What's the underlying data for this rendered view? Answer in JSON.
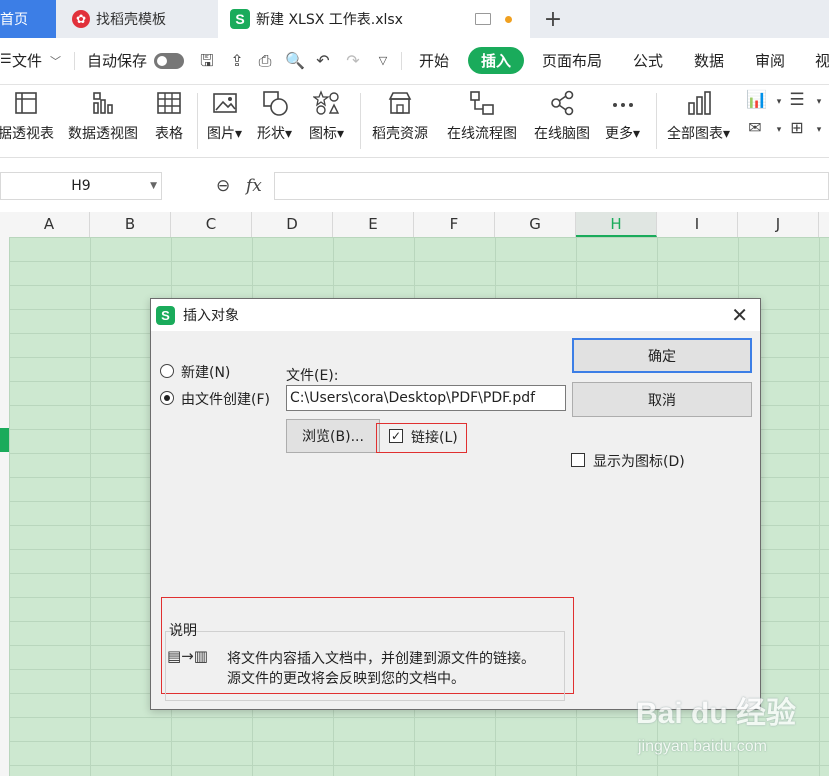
{
  "tabs": {
    "home": "首页",
    "template": "找稻壳模板",
    "file": "新建 XLSX 工作表.xlsx",
    "add": "+"
  },
  "menu": {
    "file": "文件",
    "autosave": "自动保存",
    "start": "开始",
    "insert": "插入",
    "page_layout": "页面布局",
    "formula": "公式",
    "data": "数据",
    "review": "审阅",
    "view": "视"
  },
  "ribbon": {
    "pivot_table": "据透视表",
    "pivot_chart": "数据透视图",
    "table": "表格",
    "picture": "图片",
    "shape": "形状",
    "icon": "图标",
    "docer_resources": "稻壳资源",
    "online_flowchart": "在线流程图",
    "online_mindmap": "在线脑图",
    "more": "更多",
    "all_charts": "全部图表"
  },
  "formula_bar": {
    "cell_ref": "H9",
    "fx": "fx",
    "content": ""
  },
  "columns": [
    "A",
    "B",
    "C",
    "D",
    "E",
    "F",
    "G",
    "H",
    "I",
    "J"
  ],
  "active_column": "H",
  "dialog": {
    "title": "插入对象",
    "radio_new": "新建(N)",
    "radio_from_file": "由文件创建(F)",
    "file_label": "文件(E):",
    "file_path": "C:\\Users\\cora\\Desktop\\PDF\\PDF.pdf",
    "browse": "浏览(B)...",
    "link": "链接(L)",
    "link_checked": true,
    "display_as_icon": "显示为图标(D)",
    "ok": "确定",
    "cancel": "取消",
    "description_title": "说明",
    "description_line1": "将文件内容插入文档中，并创建到源文件的链接。",
    "description_line2": "源文件的更改将会反映到您的文档中。"
  },
  "watermark": {
    "brand": "Bai du 经验",
    "url": "jingyan.baidu.com"
  },
  "colors": {
    "accent_green": "#1aab5b",
    "home_tab": "#3c7ee6",
    "highlight_red": "#e03030",
    "sheet_bg": "#cde8d0"
  }
}
